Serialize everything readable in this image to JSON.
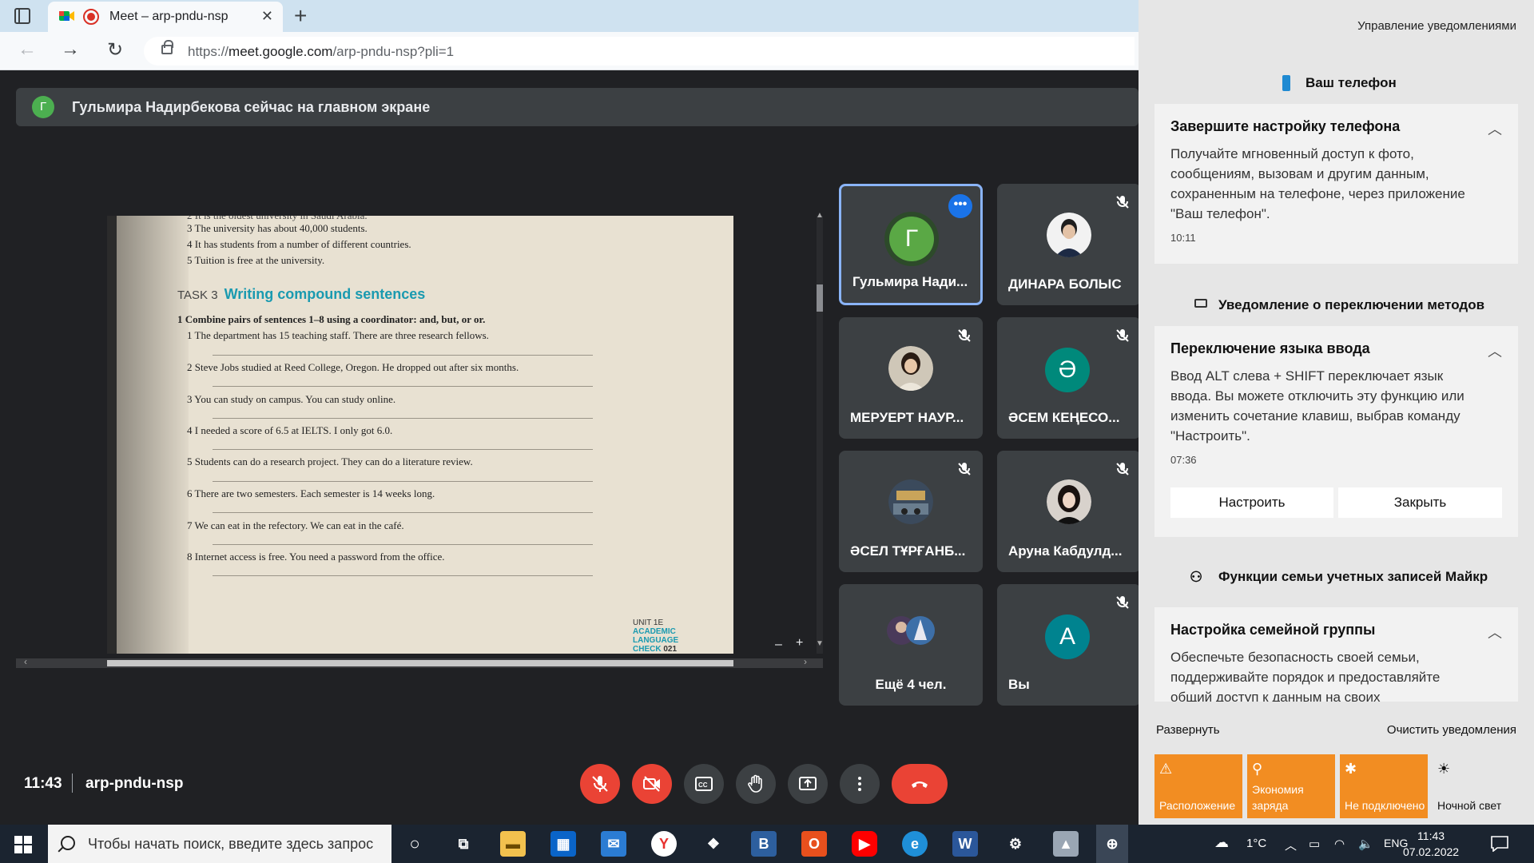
{
  "browser": {
    "tab_title": "Meet – arp-pndu-nsp",
    "url_prefix": "https://",
    "url_host": "meet.google.com",
    "url_path": "/arp-pndu-nsp?pli=1"
  },
  "meet": {
    "banner_avatar": "Г",
    "banner_text": "Гульмира Надирбекова сейчас на главном экране",
    "time": "11:43",
    "code": "arp-pndu-nsp",
    "participants": [
      {
        "name": "Гульмира Нади...",
        "avatar": "Г",
        "color": "#5aa845"
      },
      {
        "name": "ДИНАРА БОЛЫС"
      },
      {
        "name": "МЕРУЕРТ НАУР..."
      },
      {
        "name": "ӘСЕМ КЕҢЕСО...",
        "avatar": "Ә",
        "color": "#00897b"
      },
      {
        "name": "ӘСЕЛ ТҰРҒАНБ..."
      },
      {
        "name": "Аруна Кабдулд..."
      },
      {
        "name": "Ещё 4 чел."
      },
      {
        "name": "Вы",
        "avatar": "А",
        "color": "#00838f"
      }
    ]
  },
  "document": {
    "cut_line": "2  It is the oldest university in Saudi Arabia.",
    "lines": [
      "3  The university has about 40,000 students.",
      "4  It has students from a number of different countries.",
      "5  Tuition is free at the university."
    ],
    "task_no": "TASK 3",
    "task_title": "Writing compound sentences",
    "instruction": "1  Combine pairs of sentences 1–8 using a coordinator: and, but, or or.",
    "items": [
      "1  The department has 15 teaching staff. There are three research fellows.",
      "2  Steve Jobs studied at Reed College, Oregon. He dropped out after six months.",
      "3  You can study on campus. You can study online.",
      "4  I needed a score of 6.5 at IELTS. I only got 6.0.",
      "5  Students can do a research project. They can do a literature review.",
      "6  There are two semesters. Each semester is 14 weeks long.",
      "7  We can eat in the refectory. We can eat in the café.",
      "8  Internet access is free. You need a password from the office."
    ],
    "footer_unit": "UNIT 1E",
    "footer_title": "ACADEMIC LANGUAGE CHECK",
    "footer_page": "021",
    "zoom_out": "–",
    "zoom_in": "+"
  },
  "action_center": {
    "manage": "Управление уведомлениями",
    "groups": [
      {
        "title": "Ваш телефон"
      },
      {
        "title": "Уведомление о переключении методов"
      },
      {
        "title": "Функции семьи учетных записей Майкр"
      }
    ],
    "cards": [
      {
        "title": "Завершите настройку телефона",
        "body": "Получайте мгновенный доступ к фото, сообщениям, вызовам и другим данным, сохраненным на телефоне, через приложение \"Ваш телефон\".",
        "time": "10:11"
      },
      {
        "title": "Переключение языка ввода",
        "body": "Ввод ALT слева + SHIFT переключает язык ввода. Вы можете отключить эту функцию или изменить сочетание клавиш, выбрав команду \"Настроить\".",
        "time": "07:36",
        "btn_primary": "Настроить",
        "btn_secondary": "Закрыть"
      },
      {
        "title": "Настройка семейной группы",
        "body": "Обеспечьте безопасность своей семьи, поддерживайте порядок и предоставляйте общий доступ к данным на своих"
      }
    ],
    "expand": "Развернуть",
    "clear": "Очистить уведомления",
    "quick_actions": [
      {
        "label": "Расположение",
        "icon": "⚠"
      },
      {
        "label": "Экономия заряда",
        "icon": "⚲"
      },
      {
        "label": "Не подключено",
        "icon": "✱"
      },
      {
        "label": "Ночной свет",
        "icon": "☀"
      }
    ]
  },
  "taskbar": {
    "search_placeholder": "Чтобы начать поиск, введите здесь запрос",
    "temperature": "1°C",
    "language": "ENG",
    "time": "11:43",
    "date": "07.02.2022"
  }
}
